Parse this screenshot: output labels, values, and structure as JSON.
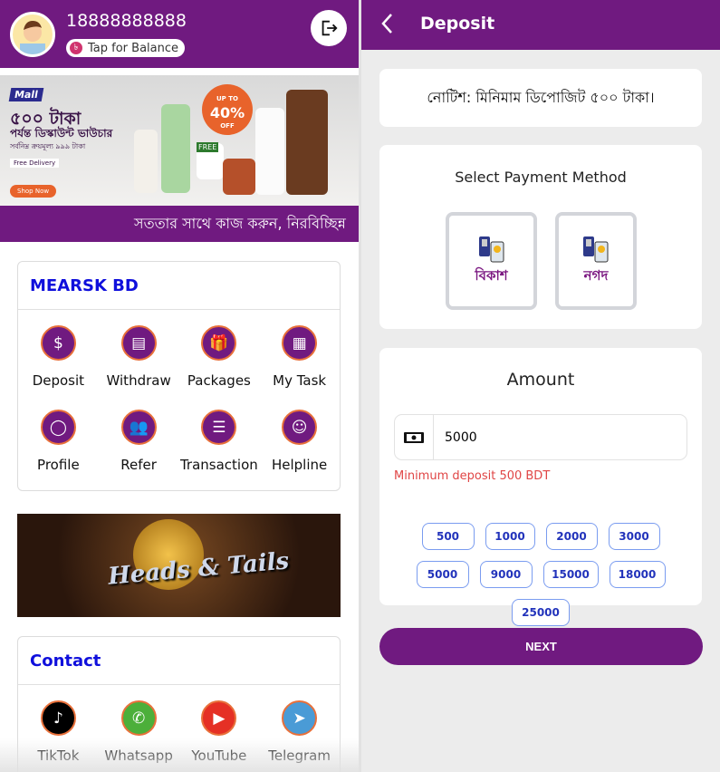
{
  "left": {
    "header": {
      "phone": "18888888888",
      "balance_label": "Tap for Balance",
      "balance_icon": "taka-icon"
    },
    "banner": {
      "brand": "Mall",
      "headline": "৫০০ টাকা",
      "subline": "পর্যন্ত ডিস্কাউন্ট ভাউচার",
      "note": "সর্বনিম্ন ক্রয়মূল্য ৯৯৯ টাকা",
      "free_delivery": "Free Delivery",
      "shop_now": "Shop Now",
      "offer_top": "UP TO",
      "offer": "40%",
      "offer_bottom": "OFF",
      "free": "FREE"
    },
    "marquee": "সততার সাথে কাজ করুন, নিরবিচ্ছিন্ন",
    "menu": {
      "title": "MEARSK BD",
      "items": [
        {
          "label": "Deposit",
          "icon": "money-bag-icon"
        },
        {
          "label": "Withdraw",
          "icon": "atm-icon"
        },
        {
          "label": "Packages",
          "icon": "gift-icon"
        },
        {
          "label": "My Task",
          "icon": "calendar-task-icon"
        },
        {
          "label": "Profile",
          "icon": "user-icon"
        },
        {
          "label": "Refer",
          "icon": "refer-users-icon"
        },
        {
          "label": "Transaction",
          "icon": "list-icon"
        },
        {
          "label": "Helpline",
          "icon": "headset-icon"
        }
      ]
    },
    "game": {
      "title": "Heads & Tails"
    },
    "contact": {
      "title": "Contact",
      "items": [
        {
          "label": "TikTok",
          "color": "#000000"
        },
        {
          "label": "Whatsapp",
          "color": "#4caf3a"
        },
        {
          "label": "YouTube",
          "color": "#e53025"
        },
        {
          "label": "Telegram",
          "color": "#4a9bd6"
        }
      ]
    }
  },
  "right": {
    "header": {
      "title": "Deposit"
    },
    "notice": "নোটিশ: মিনিমাম ডিপোজিট ৫০০ টাকা।",
    "payment": {
      "title": "Select Payment Method",
      "options": [
        "বিকাশ",
        "নগদ"
      ]
    },
    "amount": {
      "title": "Amount",
      "value": "5000",
      "error": "Minimum deposit 500 BDT",
      "presets": [
        "500",
        "1000",
        "2000",
        "3000",
        "5000",
        "9000",
        "15000",
        "18000",
        "25000"
      ]
    },
    "next_label": "NEXT"
  },
  "colors": {
    "primary": "#701a80",
    "link": "#0f0fdc",
    "error": "#e04545",
    "chip": "#2233bb"
  }
}
